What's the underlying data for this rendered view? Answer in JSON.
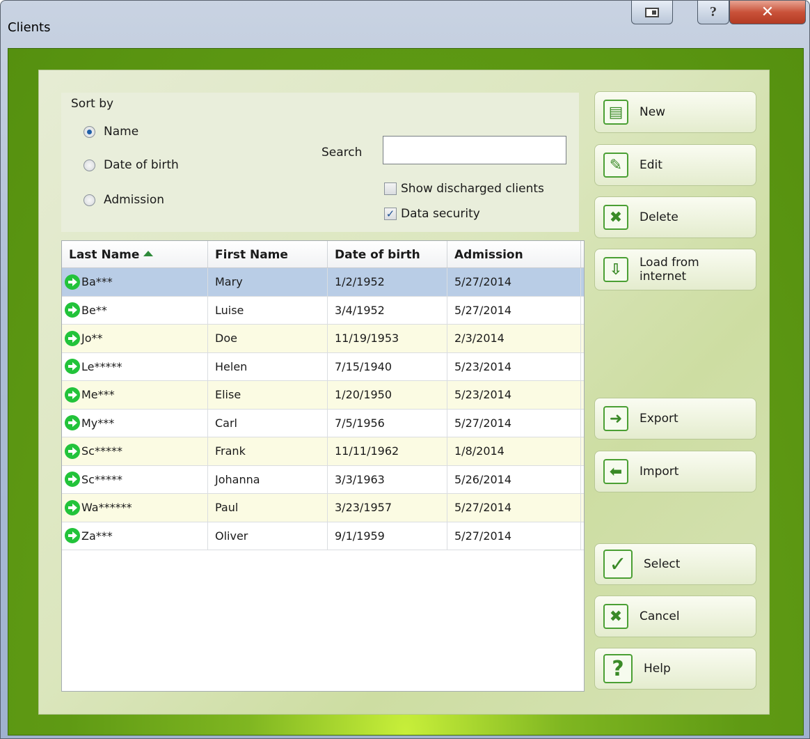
{
  "window": {
    "title": "Clients"
  },
  "sort": {
    "title": "Sort by",
    "options": [
      {
        "label": "Name",
        "checked": true
      },
      {
        "label": "Date of birth",
        "checked": false
      },
      {
        "label": "Admission",
        "checked": false
      }
    ]
  },
  "search": {
    "label": "Search",
    "value": "",
    "placeholder": ""
  },
  "checks": {
    "show_discharged": {
      "label": "Show discharged clients",
      "checked": false
    },
    "data_security": {
      "label": "Data security",
      "checked": true
    }
  },
  "table": {
    "columns": [
      "Last Name",
      "First Name",
      "Date of birth",
      "Admission"
    ],
    "sort_column": "Last Name",
    "rows": [
      [
        "Ba***",
        "Mary",
        "1/2/1952",
        "5/27/2014"
      ],
      [
        "Be**",
        "Luise",
        "3/4/1952",
        "5/27/2014"
      ],
      [
        "Jo**",
        "Doe",
        "11/19/1953",
        "2/3/2014"
      ],
      [
        "Le*****",
        "Helen",
        "7/15/1940",
        "5/23/2014"
      ],
      [
        "Me***",
        "Elise",
        "1/20/1950",
        "5/23/2014"
      ],
      [
        "My***",
        "Carl",
        "7/5/1956",
        "5/27/2014"
      ],
      [
        "Sc*****",
        "Frank",
        "11/11/1962",
        "1/8/2014"
      ],
      [
        "Sc*****",
        "Johanna",
        "3/3/1963",
        "5/26/2014"
      ],
      [
        "Wa******",
        "Paul",
        "3/23/1957",
        "5/27/2014"
      ],
      [
        "Za***",
        "Oliver",
        "9/1/1959",
        "5/27/2014"
      ]
    ],
    "selected_row": 0
  },
  "buttons": {
    "new": "New",
    "edit": "Edit",
    "delete": "Delete",
    "load": "Load from internet",
    "export": "Export",
    "import": "Import",
    "select": "Select",
    "cancel": "Cancel",
    "help": "Help"
  },
  "colors": {
    "frame_green": "#5f9a14",
    "selection": "#b9cde6",
    "alt_row": "#fbfbe3",
    "icon_green": "#22c33a"
  }
}
